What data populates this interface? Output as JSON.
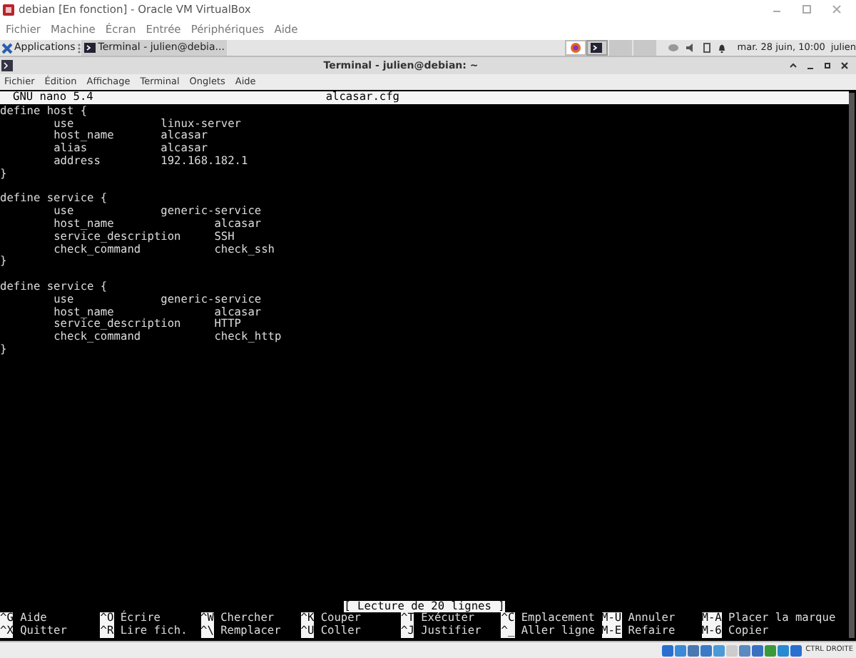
{
  "vm_window": {
    "title": "debian [En fonction] - Oracle VM VirtualBox",
    "menu": [
      "Fichier",
      "Machine",
      "Écran",
      "Entrée",
      "Périphériques",
      "Aide"
    ]
  },
  "panel": {
    "applications": "Applications",
    "tasks": [
      {
        "label": "Terminal - julien@debia...",
        "selected": true
      }
    ],
    "clock": "mar. 28 juin, 10:00",
    "user": "julien"
  },
  "terminal": {
    "title": "Terminal - julien@debian: ~",
    "menu": [
      "Fichier",
      "Édition",
      "Affichage",
      "Terminal",
      "Onglets",
      "Aide"
    ],
    "nano": {
      "version": "GNU nano 5.4",
      "filename": "alcasar.cfg",
      "blocks": [
        [
          "define host {",
          "\tuse\t\tlinux-server",
          "\thost_name\talcasar",
          "\talias\t\talcasar",
          "\taddress\t\t192.168.182.1",
          "}"
        ],
        [
          "define service {",
          "\tuse\t\tgeneric-service",
          "\thost_name\t\talcasar",
          "\tservice_description\tSSH",
          "\tcheck_command\t\tcheck_ssh",
          "}"
        ],
        [
          "define service {",
          "\tuse\t\tgeneric-service",
          "\thost_name\t\talcasar",
          "\tservice_description\tHTTP",
          "\tcheck_command\t\tcheck_http",
          "}"
        ]
      ],
      "status": "[ Lecture de 20 lignes ]",
      "shortcuts": [
        {
          "key": "^G",
          "label": "Aide"
        },
        {
          "key": "^O",
          "label": "Écrire"
        },
        {
          "key": "^W",
          "label": "Chercher"
        },
        {
          "key": "^K",
          "label": "Couper"
        },
        {
          "key": "^T",
          "label": "Exécuter"
        },
        {
          "key": "^C",
          "label": "Emplacement"
        },
        {
          "key": "M-U",
          "label": "Annuler"
        },
        {
          "key": "M-A",
          "label": "Placer la marque"
        },
        {
          "key": "^X",
          "label": "Quitter"
        },
        {
          "key": "^R",
          "label": "Lire fich."
        },
        {
          "key": "^\\",
          "label": "Remplacer"
        },
        {
          "key": "^U",
          "label": "Coller"
        },
        {
          "key": "^J",
          "label": "Justifier"
        },
        {
          "key": "^_",
          "label": "Aller ligne"
        },
        {
          "key": "M-E",
          "label": "Refaire"
        },
        {
          "key": "M-6",
          "label": "Copier"
        }
      ]
    }
  },
  "vm_status": {
    "host_key": "CTRL DROITE"
  }
}
